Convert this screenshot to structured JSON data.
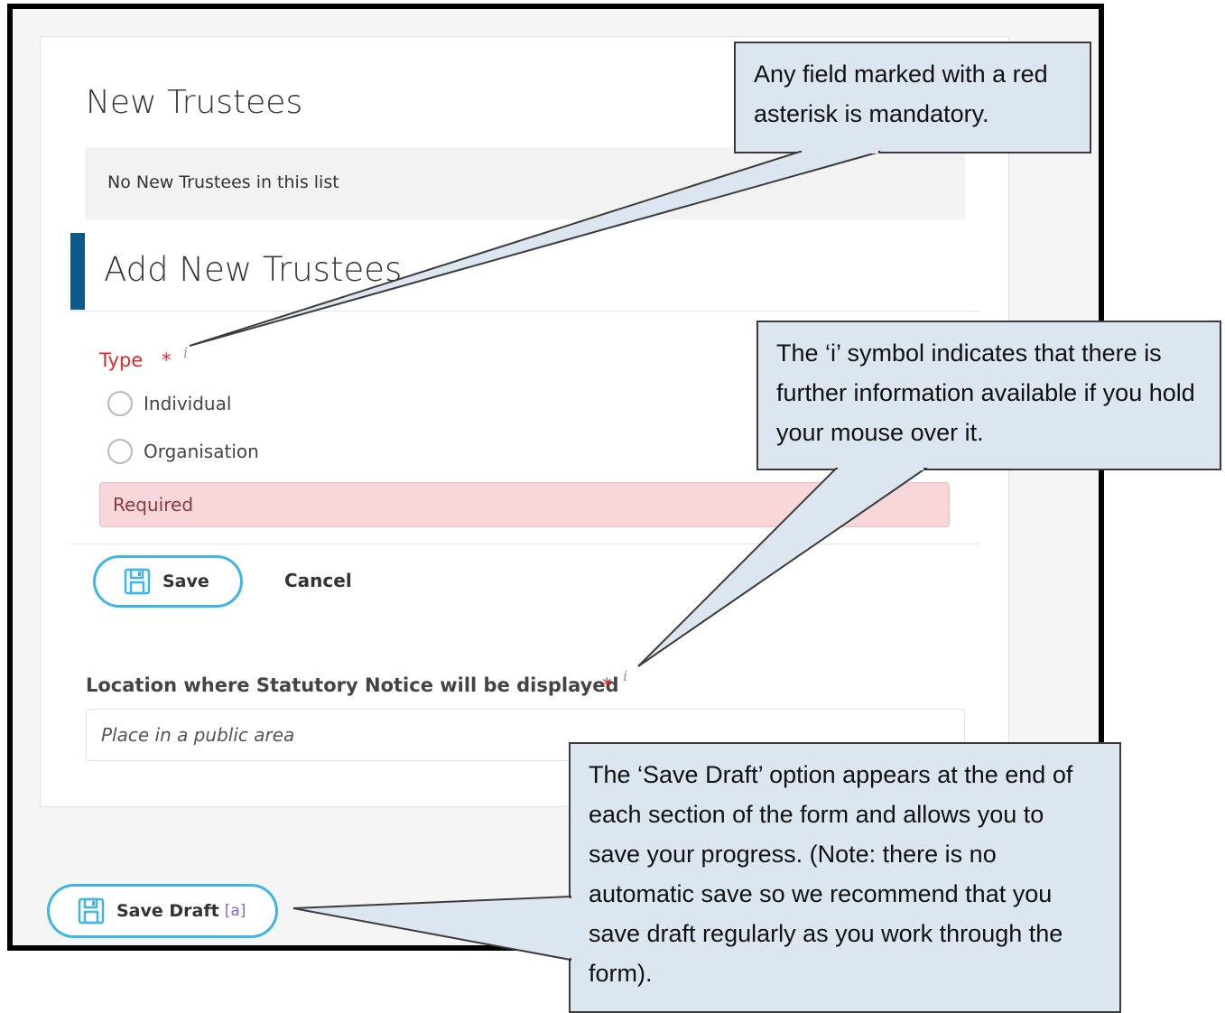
{
  "form": {
    "new_trustees_title": "New Trustees",
    "empty_message": "No New Trustees in this list",
    "add_title": "Add New Trustees",
    "type_label": "Type",
    "required_mark": "*",
    "info_symbol": "i",
    "type_options": [
      "Individual",
      "Organisation"
    ],
    "validation_message": "Required",
    "save_label": "Save",
    "cancel_label": "Cancel",
    "location_label": "Location where Statutory Notice will be displayed",
    "location_value": "Place in a public area",
    "save_draft_label": "Save Draft",
    "save_draft_shortcut": "[a]"
  },
  "callouts": {
    "mandatory": "Any field marked with a red asterisk is mandatory.",
    "info": "The ‘i’ symbol indicates that there is further information available if you hold your mouse over it.",
    "save_draft": "The ‘Save Draft’ option appears at the end of each section of the form and allows you to save your progress.  (Note: there is no automatic save so we recommend that you save draft regularly as you work through the form)."
  },
  "colors": {
    "required_red": "#e0282d",
    "button_border": "#3fb4e8",
    "section_bar": "#0b5a8a",
    "callout_fill": "#dce6f1",
    "error_fill": "#f7d7d9"
  },
  "icons": [
    "floppy-disk-icon",
    "info-icon",
    "radio-unchecked-icon"
  ]
}
